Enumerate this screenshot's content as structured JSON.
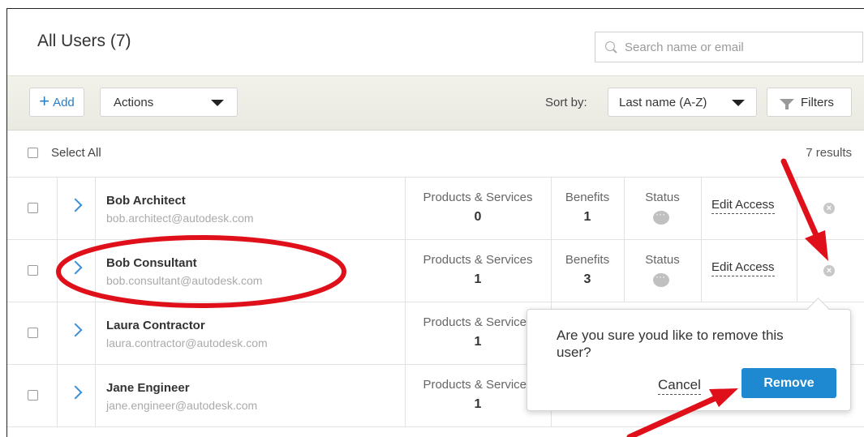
{
  "header": {
    "title": "All Users (7)",
    "search_placeholder": "Search name or email"
  },
  "toolbar": {
    "add_label": "Add",
    "actions_label": "Actions",
    "sort_label": "Sort by:",
    "sort_value": "Last name (A-Z)",
    "filters_label": "Filters"
  },
  "list": {
    "select_all_label": "Select All",
    "results_label": "7 results",
    "column_products": "Products & Services",
    "column_benefits": "Benefits",
    "column_status": "Status",
    "edit_access_label": "Edit Access",
    "rows": [
      {
        "name": "Bob Architect",
        "email": "bob.architect@autodesk.com",
        "products": "0",
        "benefits": "1"
      },
      {
        "name": "Bob Consultant",
        "email": "bob.consultant@autodesk.com",
        "products": "1",
        "benefits": "3"
      },
      {
        "name": "Laura Contractor",
        "email": "laura.contractor@autodesk.com",
        "products": "1",
        "benefits": ""
      },
      {
        "name": "Jane Engineer",
        "email": "jane.engineer@autodesk.com",
        "products": "1",
        "benefits": ""
      }
    ]
  },
  "popover": {
    "message": "Are you sure youd like to remove this user?",
    "cancel_label": "Cancel",
    "remove_label": "Remove"
  },
  "colors": {
    "accent": "#1e88d0",
    "annotation": "#e0101a",
    "toolbar_bg": "#eeede6"
  }
}
